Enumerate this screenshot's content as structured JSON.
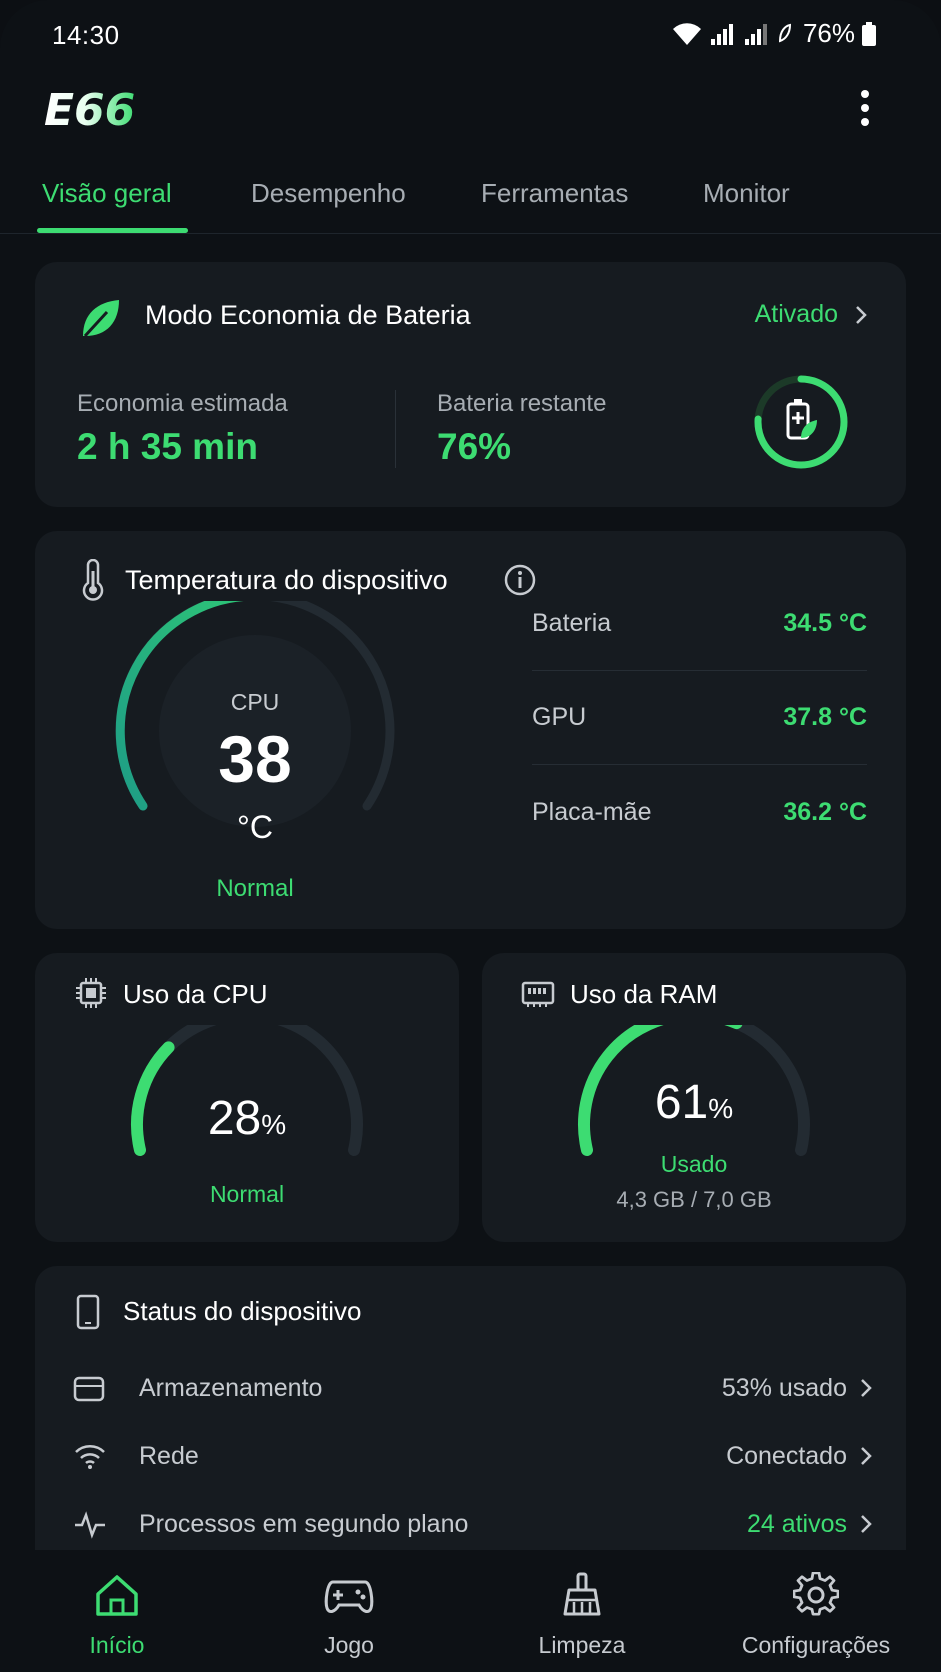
{
  "status_bar": {
    "time": "14:30",
    "battery_percent": "76%"
  },
  "app": {
    "logo_text": "E66"
  },
  "tabs": [
    {
      "label": "Visão geral",
      "active": true
    },
    {
      "label": "Desempenho",
      "active": false
    },
    {
      "label": "Ferramentas",
      "active": false
    },
    {
      "label": "Monitor",
      "active": false
    }
  ],
  "battery_saver": {
    "title": "Modo Economia de Bateria",
    "status": "Ativado",
    "estimated_label": "Economia estimada",
    "estimated_value": "2 h 35 min",
    "remaining_label": "Bateria restante",
    "remaining_value": "76%",
    "remaining_fraction": 0.76
  },
  "temperature": {
    "title": "Temperatura do dispositivo",
    "gauge_label": "CPU",
    "gauge_value": "38",
    "gauge_unit": "°C",
    "gauge_status": "Normal",
    "rows": [
      {
        "label": "Bateria",
        "value": "34.5 °C"
      },
      {
        "label": "GPU",
        "value": "37.8 °C"
      },
      {
        "label": "Placa-mãe",
        "value": "36.2 °C"
      }
    ]
  },
  "cpu_usage": {
    "title": "Uso da CPU",
    "value": "28",
    "unit": "%",
    "status": "Normal",
    "fraction": 0.28
  },
  "ram_usage": {
    "title": "Uso da RAM",
    "value": "61",
    "unit": "%",
    "status": "Usado",
    "detail": "4,3 GB / 7,0 GB",
    "fraction": 0.61
  },
  "device_status": {
    "title": "Status do dispositivo",
    "rows": [
      {
        "label": "Armazenamento",
        "value": "53% usado",
        "icon": "storage-icon"
      },
      {
        "label": "Rede",
        "value": "Conectado",
        "icon": "wifi-icon"
      },
      {
        "label": "Processos em segundo plano",
        "value": "24 ativos",
        "icon": "activity-icon"
      }
    ]
  },
  "bottom_nav": [
    {
      "label": "Início",
      "icon": "home-icon",
      "active": true
    },
    {
      "label": "Jogo",
      "icon": "gamepad-icon",
      "active": false
    },
    {
      "label": "Limpeza",
      "icon": "broom-icon",
      "active": false
    },
    {
      "label": "Configurações",
      "icon": "gear-icon",
      "active": false
    }
  ],
  "colors": {
    "accent": "#3ddc72",
    "card": "#161b20",
    "background": "#0d1115"
  }
}
